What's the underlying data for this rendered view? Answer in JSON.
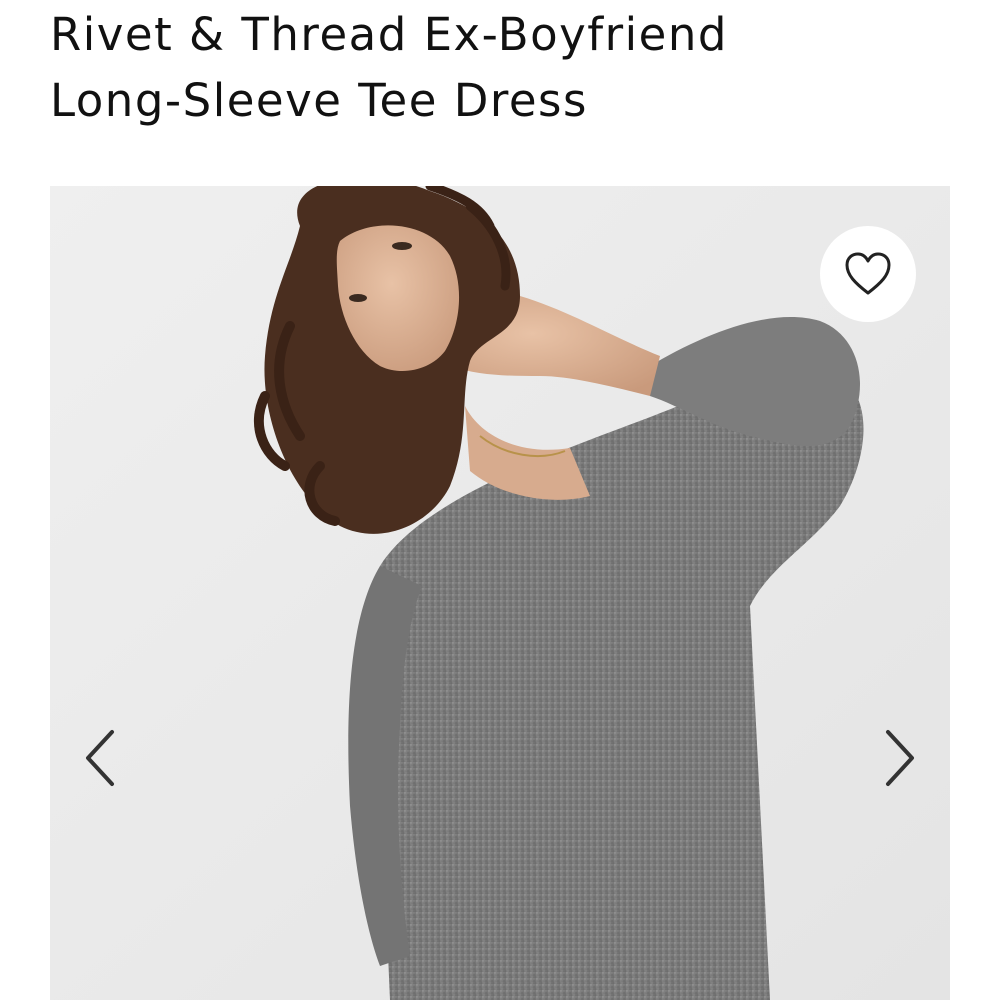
{
  "product": {
    "title_line_1": "Rivet & Thread Ex-Boyfriend",
    "title_line_2": "Long-Sleeve Tee Dress"
  },
  "gallery": {
    "image_description_icon": "product-photo",
    "favorite_icon": "heart-outline-icon",
    "prev_icon": "chevron-left-icon",
    "next_icon": "chevron-right-icon"
  },
  "colors": {
    "text": "#111111",
    "photo_background": "#ececec",
    "garment": "#7a7a7a",
    "icon": "#333333"
  }
}
